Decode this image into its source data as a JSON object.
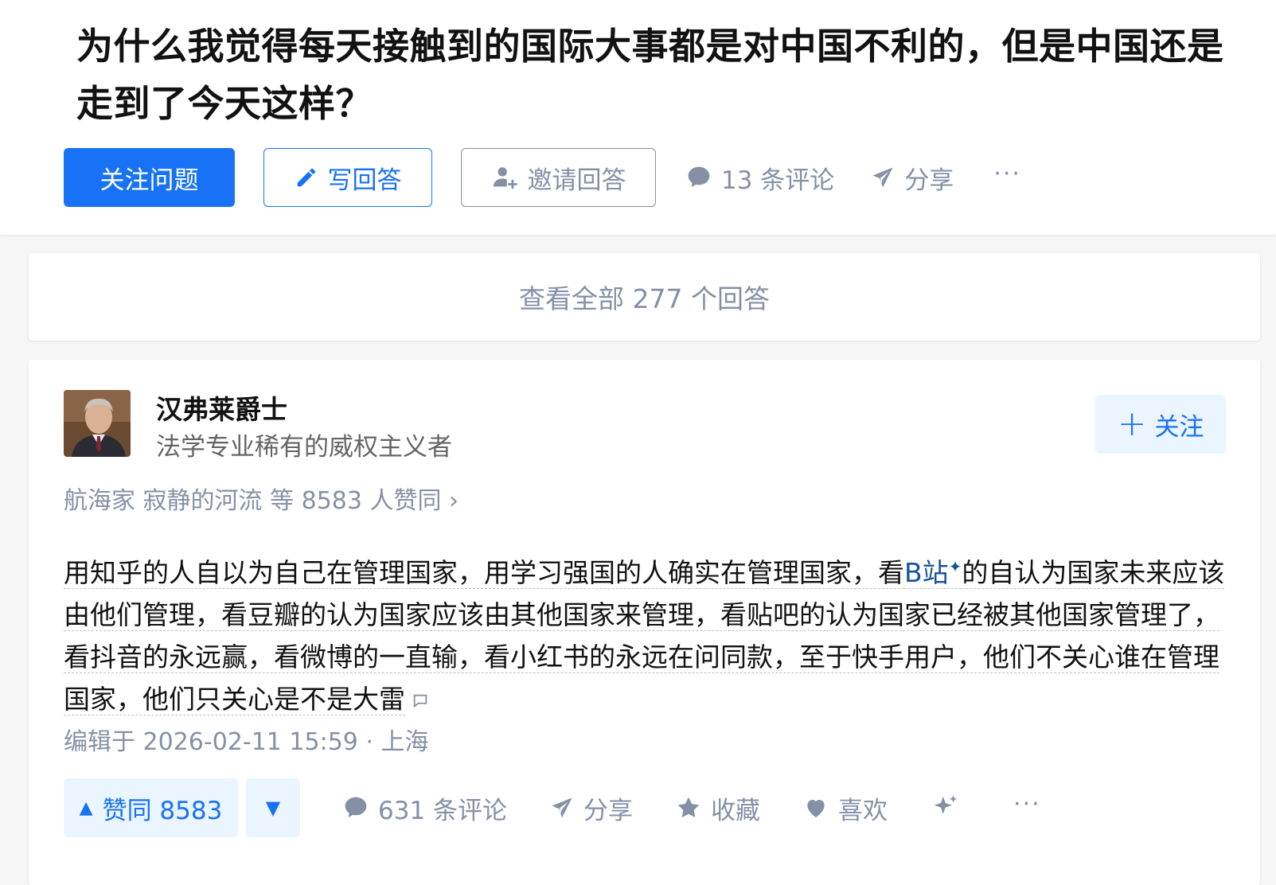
{
  "question": {
    "title": "为什么我觉得每天接触到的国际大事都是对中国不利的，但是中国还是走到了今天这样？",
    "follow_label": "关注问题",
    "write_label": "写回答",
    "invite_label": "邀请回答",
    "comments_label": "13 条评论",
    "share_label": "分享",
    "more_label": "···"
  },
  "view_all": {
    "label": "查看全部 277 个回答"
  },
  "answer": {
    "author": {
      "name": "汉弗莱爵士",
      "bio": "法学专业稀有的威权主义者",
      "follow_label": "关注"
    },
    "voters_text": "航海家 寂静的河流 等 8583 人赞同 ›",
    "content": {
      "part1": "用知乎的人自以为自己在管理国家，用学习强国的人确实在管理国家，看",
      "link": "B站",
      "part2": "的自认为国家未来应该由他们管理，看豆瓣的认为国家应该由其他国家来管理，看贴吧的认为国家已经被其他国家管理了，看抖音的永远赢，看微博的一直输，看小红书的永远在问同款，至于快手用户，他们不关心谁在管理国家，他们只关心是不是大雷"
    },
    "edit_time": "编辑于 2026-02-11 15:59 · 上海",
    "actions": {
      "upvote_label": "赞同 8583",
      "comments_label": "631 条评论",
      "share_label": "分享",
      "collect_label": "收藏",
      "like_label": "喜欢",
      "more_label": "···"
    }
  },
  "colors": {
    "brand_blue": "#1772f6",
    "light_blue_bg": "#ebf5ff",
    "muted_gray": "#8590a6",
    "link_blue": "#175199"
  }
}
